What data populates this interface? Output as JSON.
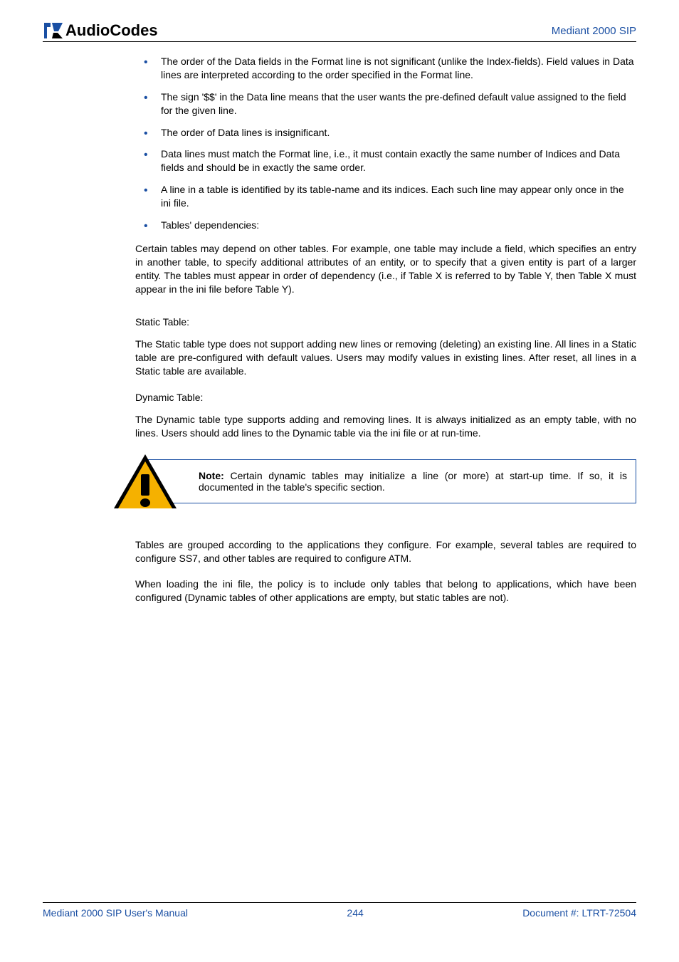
{
  "header": {
    "brand_a": "Audio",
    "brand_b": "Codes",
    "product": "Mediant 2000 SIP"
  },
  "bullets": {
    "b1": "The order of the Data fields in the Format line is not significant (unlike the Index-fields). Field values in Data lines are interpreted according to the order specified in the Format line.",
    "b2": "The sign '$$' in the Data line means that the user wants the pre-defined default value assigned to the field for the given line.",
    "b3": "The order of Data lines is insignificant.",
    "b4": "Data lines must match the Format line, i.e., it must contain exactly the same number of Indices and Data fields and should be in exactly the same order.",
    "b5": "A line in a table is identified by its table-name and its indices. Each such line may appear only once in the ini file.",
    "b6": "Tables' dependencies:"
  },
  "paras": {
    "dep": "Certain tables may depend on other tables. For example, one table may include a field, which specifies an entry in another table, to specify additional attributes of an entity, or to specify that a given entity is part of a larger entity. The tables must appear in order of dependency (i.e., if Table X is referred to by Table Y, then Table X must appear in the ini file before Table Y).",
    "static_title": "Static Table:",
    "static_body": "The Static table type does not support adding new lines or removing (deleting) an existing line. All lines in a Static table are pre-configured with default values. Users may modify values in existing lines. After reset, all lines in a Static table are available.",
    "dynamic_title": "Dynamic Table:",
    "dynamic_body": "The Dynamic table type supports adding and removing lines. It is always initialized as an empty table, with no lines. Users should add lines to the Dynamic table via the ini file or at run-time.",
    "group_body": "Tables are grouped according to the applications they configure. For example, several tables are required to configure SS7, and other tables are required to configure ATM.",
    "load_body": "When loading the ini file, the policy is to include only tables that belong to applications, which have been configured (Dynamic tables of other applications are empty, but static tables are not)."
  },
  "note": {
    "label": "Note:",
    "text": " Certain dynamic tables may initialize a line (or more) at start-up time. If so, it is documented in the table's specific section."
  },
  "footer": {
    "left": "Mediant 2000 SIP User's Manual",
    "center": "244",
    "right": "Document #: LTRT-72504"
  }
}
